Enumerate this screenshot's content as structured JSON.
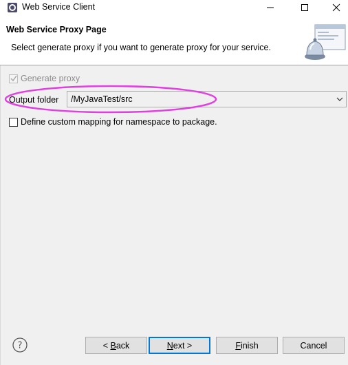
{
  "window": {
    "title": "Web Service Client"
  },
  "banner": {
    "title": "Web Service Proxy Page",
    "description": "Select generate proxy if you want to generate proxy for your service."
  },
  "form": {
    "generate_proxy": {
      "label": "Generate proxy",
      "checked": true,
      "enabled": false
    },
    "output_folder": {
      "label": "Output folder",
      "value": "/MyJavaTest/src"
    },
    "custom_mapping": {
      "label": "Define custom mapping for namespace to package.",
      "checked": false
    }
  },
  "buttons": {
    "back": {
      "prefix": "< ",
      "mnemonic": "B",
      "rest": "ack"
    },
    "next": {
      "mnemonic": "N",
      "rest": "ext >"
    },
    "finish": {
      "mnemonic": "F",
      "rest": "inish"
    },
    "cancel": "Cancel"
  },
  "icons": {
    "app": "eclipse-icon",
    "help": "help-icon",
    "banner": "web-service-bell-icon"
  },
  "colors": {
    "annotation": "#e040e0",
    "default_button_border": "#0078d7",
    "dialog_background": "#f0f0f0"
  }
}
